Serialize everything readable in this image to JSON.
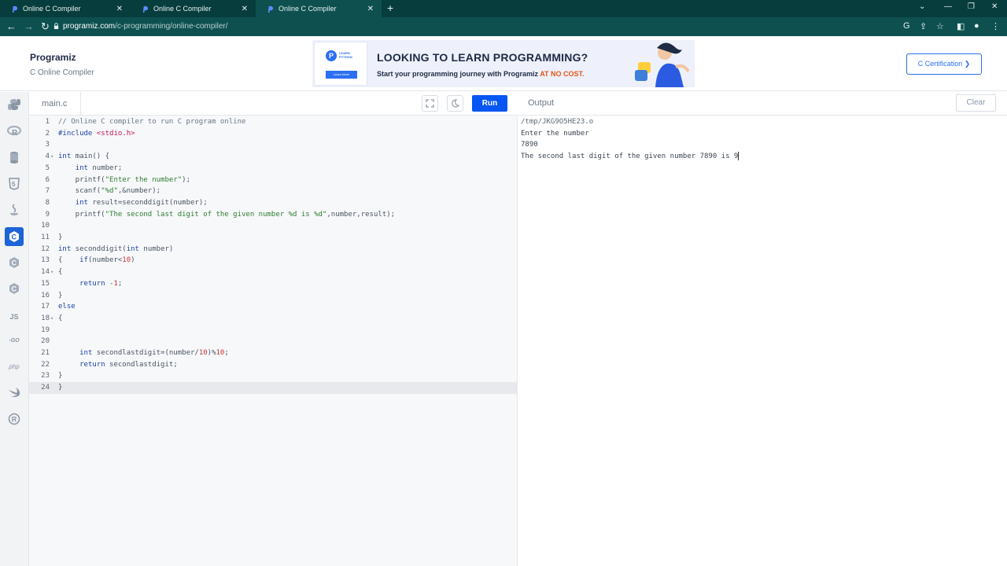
{
  "browser": {
    "tabs": [
      {
        "title": "Online C Compiler",
        "close": "✕"
      },
      {
        "title": "Online C Compiler",
        "close": "✕"
      },
      {
        "title": "Online C Compiler",
        "close": "✕"
      }
    ],
    "new_tab": "+",
    "url_host": "programiz.com",
    "url_path": "/c-programming/online-compiler/"
  },
  "header": {
    "logo": "Programiz",
    "subtitle": "C Online Compiler",
    "banner": {
      "card_badge": "P",
      "card_label_1": "LEARN",
      "card_label_2": "PYTHON",
      "card_button": "Learn More",
      "headline": "LOOKING TO LEARN PROGRAMMING?",
      "sub_prefix": "Start your programming journey with Programiz ",
      "sub_highlight": "AT NO COST."
    },
    "cert_button": "C Certification ❯"
  },
  "sidebar": {
    "languages": [
      {
        "name": "python",
        "glyph": "🐍"
      },
      {
        "name": "r",
        "glyph": "R"
      },
      {
        "name": "sql",
        "glyph": "≣"
      },
      {
        "name": "html",
        "glyph": "5"
      },
      {
        "name": "java",
        "glyph": "☕"
      },
      {
        "name": "c",
        "glyph": "C"
      },
      {
        "name": "cpp",
        "glyph": "C"
      },
      {
        "name": "csharp",
        "glyph": "C"
      },
      {
        "name": "javascript",
        "glyph": "JS"
      },
      {
        "name": "go",
        "glyph": "GO"
      },
      {
        "name": "php",
        "glyph": "php"
      },
      {
        "name": "swift",
        "glyph": "➶"
      },
      {
        "name": "rust",
        "glyph": "R"
      }
    ],
    "active": "c"
  },
  "editor": {
    "filename": "main.c",
    "run_label": "Run",
    "lines": [
      "// Online C compiler to run C program online",
      "#include <stdio.h>",
      "",
      "int main() {",
      "    int number;",
      "    printf(\"Enter the number\");",
      "    scanf(\"%d\",&number);",
      "    int result=seconddigit(number);",
      "    printf(\"The second last digit of the given number %d is %d\",number,result);",
      "",
      "}",
      "int seconddigit(int number)",
      "{    if(number<10)",
      "{",
      "     return -1;",
      "}",
      "else",
      "{",
      "",
      "",
      "     int secondlastdigit=(number/10)%10;",
      "     return secondlastdigit;",
      "}",
      "}"
    ]
  },
  "output": {
    "title": "Output",
    "clear_label": "Clear",
    "lines": [
      "/tmp/JKG9O5HE23.o",
      "Enter the number",
      "7890",
      "The second last digit of the given number 7890 is 9"
    ]
  }
}
